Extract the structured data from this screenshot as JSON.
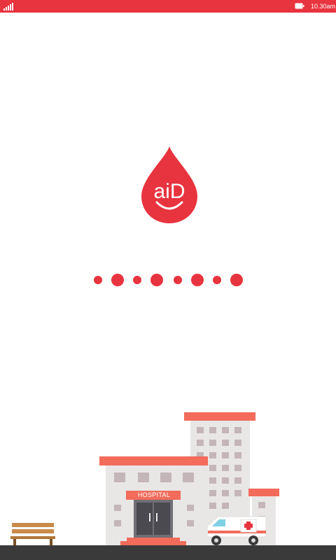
{
  "status_bar": {
    "time": "10.30am",
    "signal_icon": "signal-strength-icon",
    "battery_icon": "battery-icon"
  },
  "logo": {
    "text": "aiD",
    "icon": "blood-drop-smile-icon"
  },
  "loading": {
    "dot_count": 8,
    "icon": "loading-dots-indicator"
  },
  "scene": {
    "hospital_sign": "HOSPITAL",
    "icons": [
      "hospital-building",
      "ambulance",
      "park-bench"
    ]
  },
  "colors": {
    "brand_red": "#e8343f",
    "roof_orange": "#f26b5b",
    "building_gray": "#e9e6e6",
    "window_gray": "#c4b6b8",
    "ground": "#3a3a3a"
  }
}
